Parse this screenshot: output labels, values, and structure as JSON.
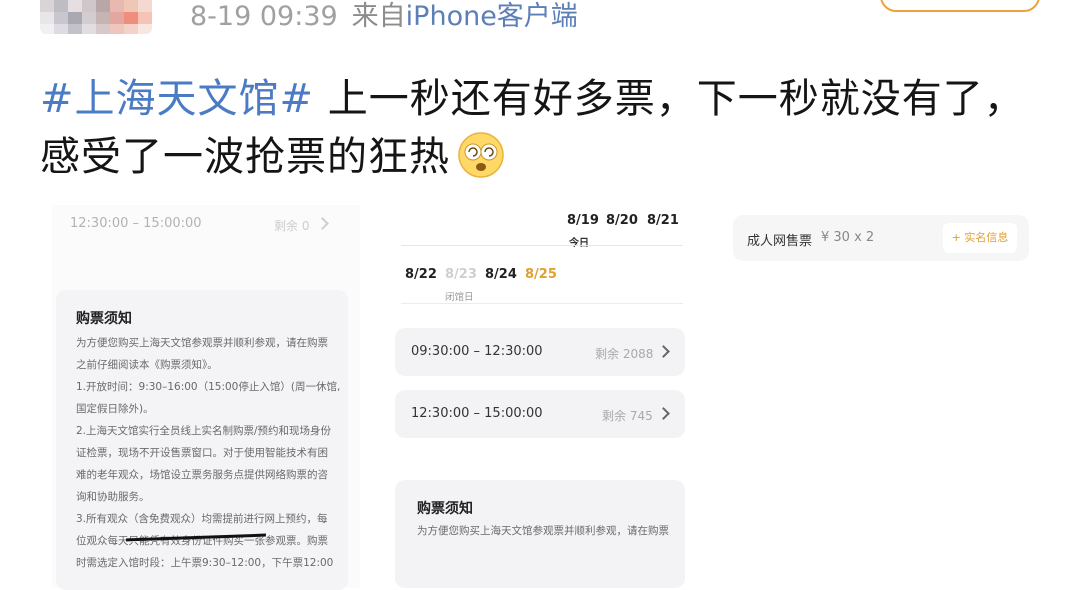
{
  "post_header": {
    "time": "8-19 09:39",
    "from_prefix": "来自",
    "source": "iPhone客户端"
  },
  "post": {
    "hashtag": "#上海天文馆#",
    "text": "上一秒还有好多票，下一秒就没有了，感受了一波抢票的狂热"
  },
  "left_screen": {
    "top_slot": {
      "time": "12:30:00 – 15:00:00",
      "remain": "剩余 0"
    },
    "notice_title": "购票须知",
    "notice_lines": [
      "为方便您购买上海天文馆参观票并顺利参观，请在购票",
      "之前仔细阅读本《购票须知》。",
      "1.开放时间：9:30–16:00（15:00停止入馆）(周一休馆,",
      "国定假日除外)。",
      "2.上海天文馆实行全员线上实名制购票/预约和现场身份",
      "证检票，现场不开设售票窗口。对于使用智能技术有困",
      "难的老年观众，场馆设立票务服务点提供网络购票的咨",
      "询和协助服务。",
      "3.所有观众（含免费观众）均需提前进行网上预约，每",
      "位观众每天只能凭有效身份证件购买一张参观票。购票",
      "时需选定入馆时段：上午票9:30–12:00，下午票12:00"
    ]
  },
  "middle_screen": {
    "top_dates": [
      "8/19",
      "8/20",
      "8/21"
    ],
    "today_label": "今日",
    "dates": [
      {
        "label": "8/22",
        "state": "normal"
      },
      {
        "label": "8/23",
        "state": "disabled"
      },
      {
        "label": "8/24",
        "state": "normal"
      },
      {
        "label": "8/25",
        "state": "selected"
      }
    ],
    "closed_label": "闭馆日",
    "slots": [
      {
        "time": "09:30:00 – 12:30:00",
        "remain": "剩余 2088"
      },
      {
        "time": "12:30:00 – 15:00:00",
        "remain": "剩余 745"
      }
    ],
    "notice_title": "购票须知",
    "notice_lines": [
      "为方便您购买上海天文馆参观票并顺利参观，请在购票"
    ]
  },
  "right_screen": {
    "ticket_name": "成人网售票",
    "ticket_price": "¥ 30 x 2",
    "realname_button": "+ 实名信息"
  },
  "colors": {
    "hashtag": "#4a7bc4",
    "accent_orange": "#f0a13a",
    "selected_date": "#e0a030"
  }
}
